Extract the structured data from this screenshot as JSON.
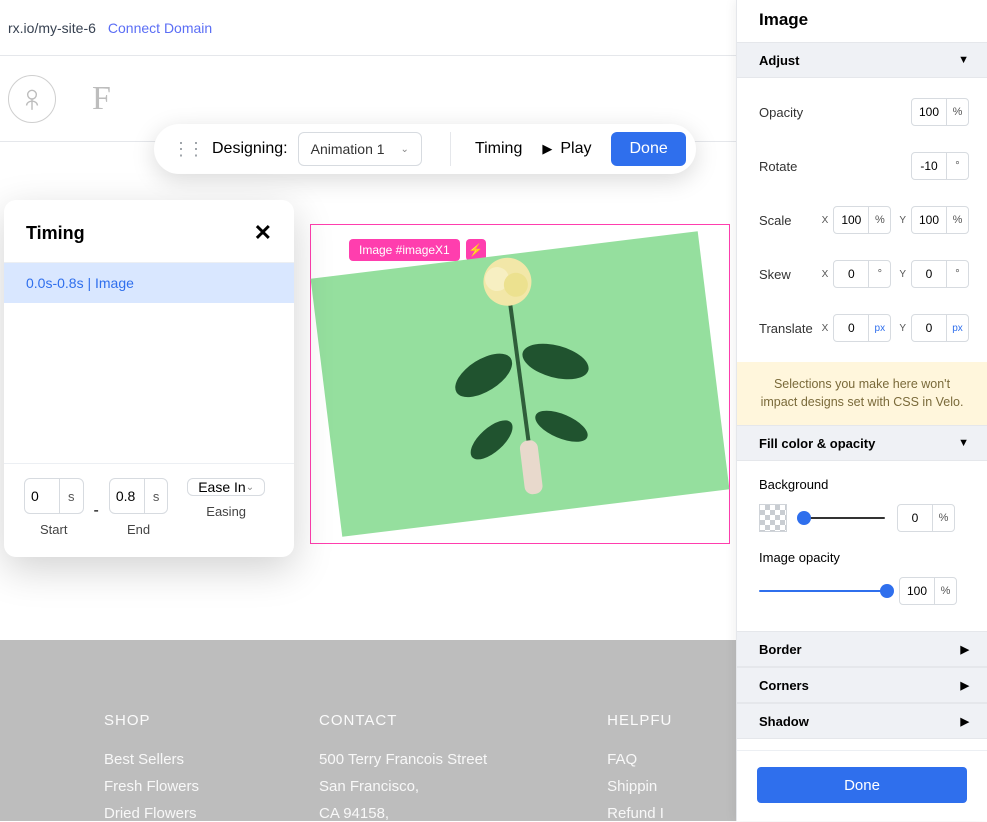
{
  "addr": {
    "url": "rx.io/my-site-6",
    "connect": "Connect Domain"
  },
  "brand": {
    "letter": "F"
  },
  "toolbar": {
    "designing": "Designing:",
    "animation_select": "Animation 1",
    "timing": "Timing",
    "play": "Play",
    "done": "Done"
  },
  "timing_panel": {
    "title": "Timing",
    "row": "0.0s-0.8s | Image",
    "start_val": "0",
    "end_val": "0.8",
    "unit": "s",
    "start_label": "Start",
    "end_label": "End",
    "easing_label": "Easing",
    "easing_val": "Ease In",
    "dash": "-"
  },
  "canvas": {
    "tag": "Image #imageX1",
    "bolt": "⚡"
  },
  "footer": {
    "shop": {
      "title": "SHOP",
      "items": [
        "Best Sellers",
        "Fresh Flowers",
        "Dried Flowers"
      ]
    },
    "contact": {
      "title": "CONTACT",
      "lines": [
        "500 Terry Francois Street",
        "San Francisco,",
        "CA 94158,"
      ]
    },
    "links": {
      "title": "HELPFU",
      "items": [
        "FAQ",
        "Shippin",
        "Refund I"
      ]
    }
  },
  "right": {
    "title": "Image",
    "adjust": {
      "head": "Adjust",
      "opacity_label": "Opacity",
      "opacity_val": "100",
      "opacity_unit": "%",
      "rotate_label": "Rotate",
      "rotate_val": "-10",
      "rotate_unit": "°",
      "scale_label": "Scale",
      "scale_x": "100",
      "scale_y": "100",
      "pct": "%",
      "skew_label": "Skew",
      "skew_x": "0",
      "skew_y": "0",
      "deg": "°",
      "translate_label": "Translate",
      "tx": "0",
      "ty": "0",
      "px": "px",
      "x": "X",
      "y": "Y"
    },
    "notice": "Selections you make here won't impact designs set with CSS in Velo.",
    "fill": {
      "head": "Fill color & opacity",
      "bg_label": "Background",
      "bg_val": "0",
      "pct": "%",
      "img_label": "Image opacity",
      "img_val": "100"
    },
    "border": "Border",
    "corners": "Corners",
    "shadow": "Shadow",
    "done": "Done"
  }
}
